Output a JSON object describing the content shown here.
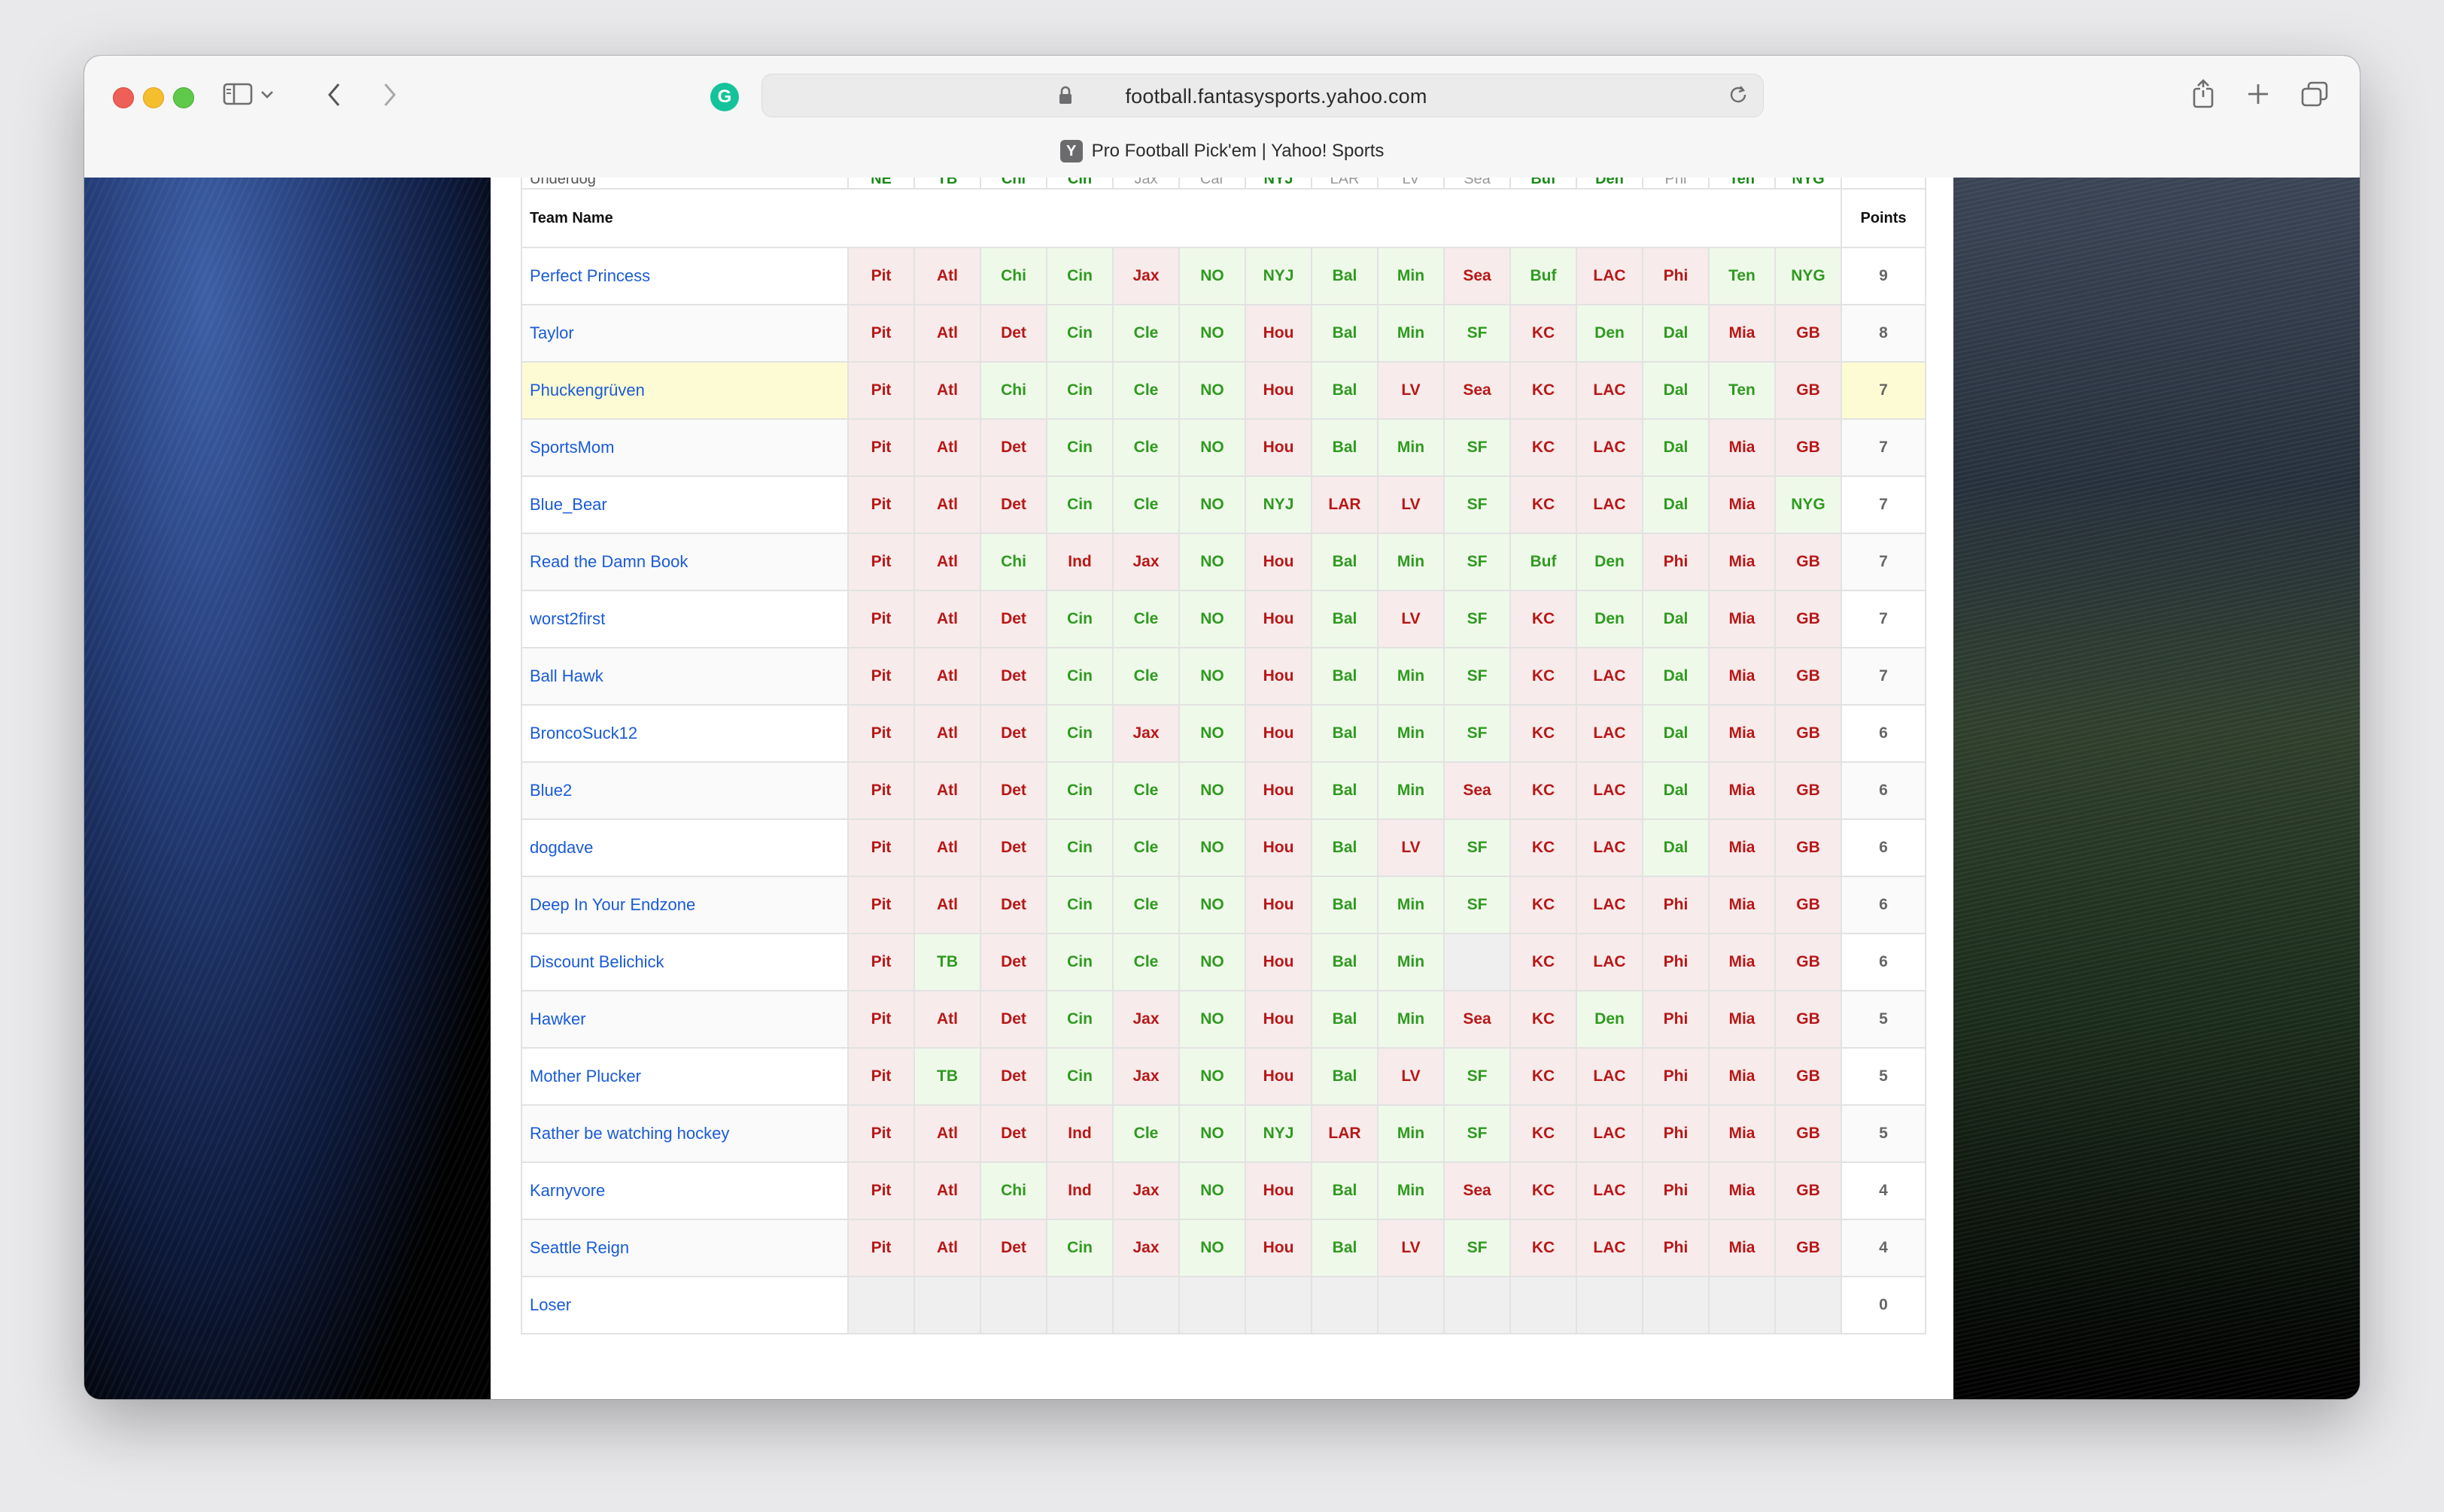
{
  "browser": {
    "url": "football.fantasysports.yahoo.com",
    "tab_title": "Pro Football Pick'em | Yahoo! Sports",
    "favicon_letter": "Y",
    "grammarly_letter": "G"
  },
  "table": {
    "underdog_label": "Underdog",
    "team_name_header": "Team Name",
    "points_header": "Points",
    "underdogs": [
      "NE",
      "TB",
      "Chi",
      "Cin",
      "Jax",
      "Car",
      "NYJ",
      "LAR",
      "LV",
      "Sea",
      "Buf",
      "Den",
      "Phi",
      "Ten",
      "NYG"
    ],
    "underdog_favored": [
      true,
      true,
      true,
      true,
      false,
      false,
      true,
      false,
      false,
      false,
      true,
      true,
      false,
      true,
      true
    ],
    "rows": [
      {
        "name": "Perfect Princess",
        "points": "9",
        "picks": [
          "Pit",
          "Atl",
          "Chi",
          "Cin",
          "Jax",
          "NO",
          "NYJ",
          "Bal",
          "Min",
          "Sea",
          "Buf",
          "LAC",
          "Phi",
          "Ten",
          "NYG"
        ],
        "result": [
          "L",
          "L",
          "W",
          "W",
          "L",
          "W",
          "W",
          "W",
          "W",
          "L",
          "W",
          "L",
          "L",
          "W",
          "W"
        ]
      },
      {
        "name": "Taylor",
        "points": "8",
        "picks": [
          "Pit",
          "Atl",
          "Det",
          "Cin",
          "Cle",
          "NO",
          "Hou",
          "Bal",
          "Min",
          "SF",
          "KC",
          "Den",
          "Dal",
          "Mia",
          "GB"
        ],
        "result": [
          "L",
          "L",
          "L",
          "W",
          "W",
          "W",
          "L",
          "W",
          "W",
          "W",
          "L",
          "W",
          "W",
          "L",
          "L"
        ]
      },
      {
        "name": "Phuckengrüven",
        "points": "7",
        "picks": [
          "Pit",
          "Atl",
          "Chi",
          "Cin",
          "Cle",
          "NO",
          "Hou",
          "Bal",
          "LV",
          "Sea",
          "KC",
          "LAC",
          "Dal",
          "Ten",
          "GB"
        ],
        "result": [
          "L",
          "L",
          "W",
          "W",
          "W",
          "W",
          "L",
          "W",
          "L",
          "L",
          "L",
          "L",
          "W",
          "W",
          "L"
        ]
      },
      {
        "name": "SportsMom",
        "points": "7",
        "picks": [
          "Pit",
          "Atl",
          "Det",
          "Cin",
          "Cle",
          "NO",
          "Hou",
          "Bal",
          "Min",
          "SF",
          "KC",
          "LAC",
          "Dal",
          "Mia",
          "GB"
        ],
        "result": [
          "L",
          "L",
          "L",
          "W",
          "W",
          "W",
          "L",
          "W",
          "W",
          "W",
          "L",
          "L",
          "W",
          "L",
          "L"
        ]
      },
      {
        "name": "Blue_Bear",
        "points": "7",
        "picks": [
          "Pit",
          "Atl",
          "Det",
          "Cin",
          "Cle",
          "NO",
          "NYJ",
          "LAR",
          "LV",
          "SF",
          "KC",
          "LAC",
          "Dal",
          "Mia",
          "NYG"
        ],
        "result": [
          "L",
          "L",
          "L",
          "W",
          "W",
          "W",
          "W",
          "L",
          "L",
          "W",
          "L",
          "L",
          "W",
          "L",
          "W"
        ]
      },
      {
        "name": "Read the Damn Book",
        "points": "7",
        "picks": [
          "Pit",
          "Atl",
          "Chi",
          "Ind",
          "Jax",
          "NO",
          "Hou",
          "Bal",
          "Min",
          "SF",
          "Buf",
          "Den",
          "Phi",
          "Mia",
          "GB"
        ],
        "result": [
          "L",
          "L",
          "W",
          "L",
          "L",
          "W",
          "L",
          "W",
          "W",
          "W",
          "W",
          "W",
          "L",
          "L",
          "L"
        ]
      },
      {
        "name": "worst2first",
        "points": "7",
        "picks": [
          "Pit",
          "Atl",
          "Det",
          "Cin",
          "Cle",
          "NO",
          "Hou",
          "Bal",
          "LV",
          "SF",
          "KC",
          "Den",
          "Dal",
          "Mia",
          "GB"
        ],
        "result": [
          "L",
          "L",
          "L",
          "W",
          "W",
          "W",
          "L",
          "W",
          "L",
          "W",
          "L",
          "W",
          "W",
          "L",
          "L"
        ]
      },
      {
        "name": "Ball Hawk",
        "points": "7",
        "picks": [
          "Pit",
          "Atl",
          "Det",
          "Cin",
          "Cle",
          "NO",
          "Hou",
          "Bal",
          "Min",
          "SF",
          "KC",
          "LAC",
          "Dal",
          "Mia",
          "GB"
        ],
        "result": [
          "L",
          "L",
          "L",
          "W",
          "W",
          "W",
          "L",
          "W",
          "W",
          "W",
          "L",
          "L",
          "W",
          "L",
          "L"
        ]
      },
      {
        "name": "BroncoSuck12",
        "points": "6",
        "picks": [
          "Pit",
          "Atl",
          "Det",
          "Cin",
          "Jax",
          "NO",
          "Hou",
          "Bal",
          "Min",
          "SF",
          "KC",
          "LAC",
          "Dal",
          "Mia",
          "GB"
        ],
        "result": [
          "L",
          "L",
          "L",
          "W",
          "L",
          "W",
          "L",
          "W",
          "W",
          "W",
          "L",
          "L",
          "W",
          "L",
          "L"
        ]
      },
      {
        "name": "Blue2",
        "points": "6",
        "picks": [
          "Pit",
          "Atl",
          "Det",
          "Cin",
          "Cle",
          "NO",
          "Hou",
          "Bal",
          "Min",
          "Sea",
          "KC",
          "LAC",
          "Dal",
          "Mia",
          "GB"
        ],
        "result": [
          "L",
          "L",
          "L",
          "W",
          "W",
          "W",
          "L",
          "W",
          "W",
          "L",
          "L",
          "L",
          "W",
          "L",
          "L"
        ]
      },
      {
        "name": "dogdave",
        "points": "6",
        "picks": [
          "Pit",
          "Atl",
          "Det",
          "Cin",
          "Cle",
          "NO",
          "Hou",
          "Bal",
          "LV",
          "SF",
          "KC",
          "LAC",
          "Dal",
          "Mia",
          "GB"
        ],
        "result": [
          "L",
          "L",
          "L",
          "W",
          "W",
          "W",
          "L",
          "W",
          "L",
          "W",
          "L",
          "L",
          "W",
          "L",
          "L"
        ]
      },
      {
        "name": "Deep In Your Endzone",
        "points": "6",
        "picks": [
          "Pit",
          "Atl",
          "Det",
          "Cin",
          "Cle",
          "NO",
          "Hou",
          "Bal",
          "Min",
          "SF",
          "KC",
          "LAC",
          "Phi",
          "Mia",
          "GB"
        ],
        "result": [
          "L",
          "L",
          "L",
          "W",
          "W",
          "W",
          "L",
          "W",
          "W",
          "W",
          "L",
          "L",
          "L",
          "L",
          "L"
        ]
      },
      {
        "name": "Discount Belichick",
        "points": "6",
        "picks": [
          "Pit",
          "TB",
          "Det",
          "Cin",
          "Cle",
          "NO",
          "Hou",
          "Bal",
          "Min",
          "",
          "KC",
          "LAC",
          "Phi",
          "Mia",
          "GB"
        ],
        "result": [
          "L",
          "W",
          "L",
          "W",
          "W",
          "W",
          "L",
          "W",
          "W",
          "E",
          "L",
          "L",
          "L",
          "L",
          "L"
        ]
      },
      {
        "name": "Hawker",
        "points": "5",
        "picks": [
          "Pit",
          "Atl",
          "Det",
          "Cin",
          "Jax",
          "NO",
          "Hou",
          "Bal",
          "Min",
          "Sea",
          "KC",
          "Den",
          "Phi",
          "Mia",
          "GB"
        ],
        "result": [
          "L",
          "L",
          "L",
          "W",
          "L",
          "W",
          "L",
          "W",
          "W",
          "L",
          "L",
          "W",
          "L",
          "L",
          "L"
        ]
      },
      {
        "name": "Mother Plucker",
        "points": "5",
        "picks": [
          "Pit",
          "TB",
          "Det",
          "Cin",
          "Jax",
          "NO",
          "Hou",
          "Bal",
          "LV",
          "SF",
          "KC",
          "LAC",
          "Phi",
          "Mia",
          "GB"
        ],
        "result": [
          "L",
          "W",
          "L",
          "W",
          "L",
          "W",
          "L",
          "W",
          "L",
          "W",
          "L",
          "L",
          "L",
          "L",
          "L"
        ]
      },
      {
        "name": "Rather be watching hockey",
        "points": "5",
        "picks": [
          "Pit",
          "Atl",
          "Det",
          "Ind",
          "Cle",
          "NO",
          "NYJ",
          "LAR",
          "Min",
          "SF",
          "KC",
          "LAC",
          "Phi",
          "Mia",
          "GB"
        ],
        "result": [
          "L",
          "L",
          "L",
          "L",
          "W",
          "W",
          "W",
          "L",
          "W",
          "W",
          "L",
          "L",
          "L",
          "L",
          "L"
        ]
      },
      {
        "name": "Karnyvore",
        "points": "4",
        "picks": [
          "Pit",
          "Atl",
          "Chi",
          "Ind",
          "Jax",
          "NO",
          "Hou",
          "Bal",
          "Min",
          "Sea",
          "KC",
          "LAC",
          "Phi",
          "Mia",
          "GB"
        ],
        "result": [
          "L",
          "L",
          "W",
          "L",
          "L",
          "W",
          "L",
          "W",
          "W",
          "L",
          "L",
          "L",
          "L",
          "L",
          "L"
        ]
      },
      {
        "name": "Seattle Reign",
        "points": "4",
        "picks": [
          "Pit",
          "Atl",
          "Det",
          "Cin",
          "Jax",
          "NO",
          "Hou",
          "Bal",
          "LV",
          "SF",
          "KC",
          "LAC",
          "Phi",
          "Mia",
          "GB"
        ],
        "result": [
          "L",
          "L",
          "L",
          "W",
          "L",
          "W",
          "L",
          "W",
          "L",
          "W",
          "L",
          "L",
          "L",
          "L",
          "L"
        ]
      },
      {
        "name": "Loser",
        "points": "0",
        "picks": [
          "",
          "",
          "",
          "",
          "",
          "",
          "",
          "",
          "",
          "",
          "",
          "",
          "",
          "",
          ""
        ],
        "result": [
          "E",
          "E",
          "E",
          "E",
          "E",
          "E",
          "E",
          "E",
          "E",
          "E",
          "E",
          "E",
          "E",
          "E",
          "E"
        ]
      }
    ],
    "highlight_row": 2
  },
  "colors": {
    "win_bg": "#eff9ea",
    "win_text": "#2e9a1f",
    "loss_bg": "#f7ebeb",
    "loss_text": "#b81717",
    "link": "#1a5bd6",
    "highlight": "#fdfbd3"
  },
  "icons": [
    "sidebar-icon",
    "chevron-down-icon",
    "back-icon",
    "forward-icon",
    "lock-icon",
    "reload-icon",
    "share-icon",
    "new-tab-icon",
    "tab-overview-icon"
  ]
}
